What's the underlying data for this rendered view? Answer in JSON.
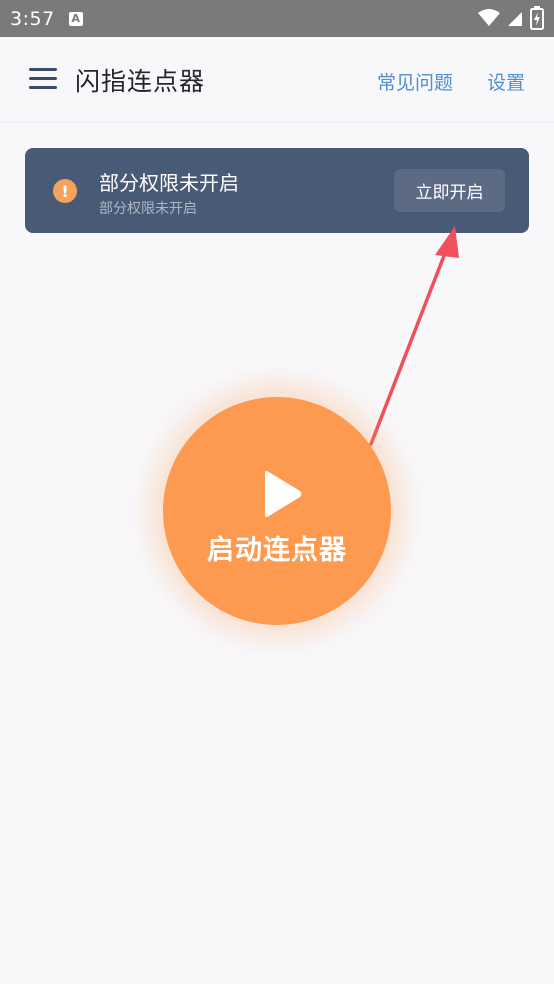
{
  "status_bar": {
    "time": "3:57",
    "keyboard_icon_letter": "A",
    "icons": [
      "wifi-icon",
      "signal-icon",
      "battery-charging-icon"
    ]
  },
  "header": {
    "title": "闪指连点器",
    "faq_label": "常见问题",
    "settings_label": "设置"
  },
  "banner": {
    "title": "部分权限未开启",
    "subtitle": "部分权限未开启",
    "button_label": "立即开启",
    "warning_glyph": "!"
  },
  "main": {
    "start_label": "启动连点器"
  },
  "colors": {
    "accent_orange": "#fe9a50",
    "banner_bg": "#495a76",
    "link_blue": "#4f8fd0",
    "arrow_red": "#f0505a"
  }
}
